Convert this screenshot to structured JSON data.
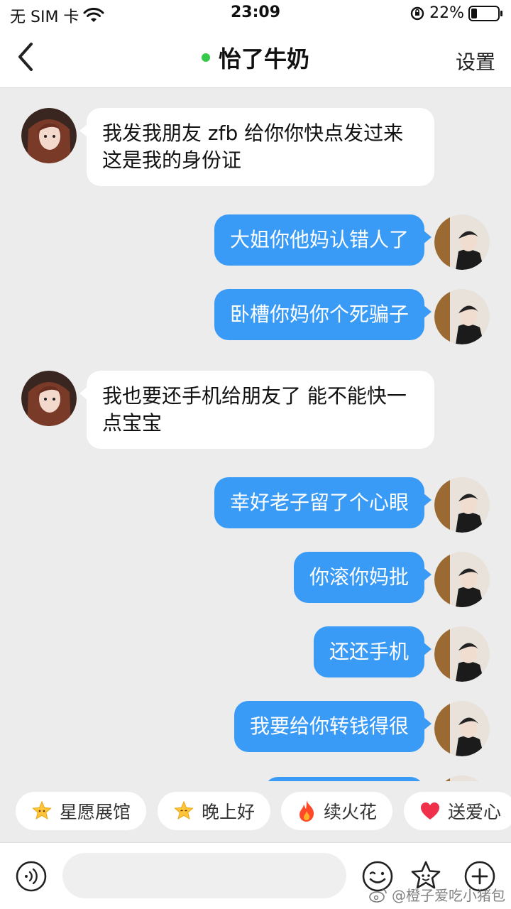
{
  "status_bar": {
    "carrier": "无 SIM 卡",
    "time": "23:09",
    "battery": "22%",
    "battery_level": 0.22
  },
  "nav": {
    "title": "怡了牛奶",
    "settings": "设置",
    "online_color": "#35c94a"
  },
  "messages": [
    {
      "from": "her",
      "text": "我发我朋友 zfb 给你你快点发过来 这是我的身份证"
    },
    {
      "from": "me",
      "text": "大姐你他妈认错人了"
    },
    {
      "from": "me",
      "text": "卧槽你妈你个死骗子"
    },
    {
      "from": "her",
      "text": "我也要还手机给朋友了 能不能快一点宝宝"
    },
    {
      "from": "me",
      "text": "幸好老子留了个心眼"
    },
    {
      "from": "me",
      "text": "你滚你妈批"
    },
    {
      "from": "me",
      "text": "还还手机"
    },
    {
      "from": "me",
      "text": "我要给你转钱得很"
    }
  ],
  "chips": [
    {
      "label": "星愿展馆",
      "icon": "star-face-icon"
    },
    {
      "label": "晚上好",
      "icon": "star-face-icon"
    },
    {
      "label": "续火花",
      "icon": "fire-icon"
    },
    {
      "label": "送爱心",
      "icon": "heart-icon"
    }
  ],
  "input": {
    "placeholder": ""
  },
  "watermark": "@橙子爱吃小猪包",
  "colors": {
    "bubble_me": "#3a9bf7",
    "bubble_her": "#ffffff",
    "background": "#ececec"
  }
}
